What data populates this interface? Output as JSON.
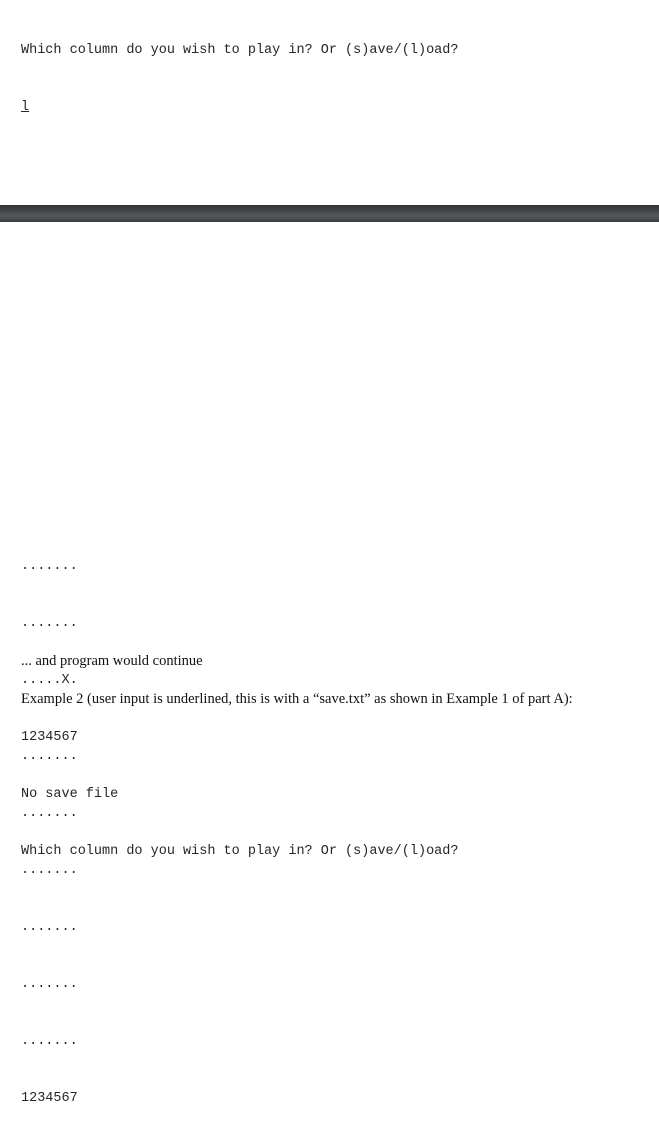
{
  "document": {
    "type": "assignment-handout-page",
    "page_break_divider_color": "#40464a",
    "background_color": "#ffffff",
    "mono_text_color": "#262626",
    "prose_text_color": "#111111"
  },
  "top_console": {
    "lines": [
      {
        "text": "Which column do you wish to play in? Or (s)ave/(l)oad?",
        "underlined": false
      },
      {
        "text": "l",
        "underlined": true
      },
      {
        "text": "",
        "underlined": false
      },
      {
        "text": ".......",
        "underlined": false
      },
      {
        "text": ".......",
        "underlined": false
      },
      {
        "text": ".......",
        "underlined": false
      }
    ]
  },
  "mid_console": {
    "lines": [
      {
        "text": ".......",
        "underlined": false
      },
      {
        "text": ".......",
        "underlined": false
      },
      {
        "text": ".....X.",
        "underlined": false
      },
      {
        "text": "1234567",
        "underlined": false
      },
      {
        "text": "No save file",
        "underlined": false
      },
      {
        "text": "Which column do you wish to play in? Or (s)ave/(l)oad?",
        "underlined": false
      }
    ]
  },
  "prose": {
    "continue_note": "... and program would continue",
    "example2_heading": "Example 2 (user input is underlined, this is with a “save.txt” as shown in Example 1 of part A):"
  },
  "bottom_console": {
    "lines": [
      {
        "text": ".......",
        "underlined": false
      },
      {
        "text": ".......",
        "underlined": false
      },
      {
        "text": ".......",
        "underlined": false
      },
      {
        "text": ".......",
        "underlined": false
      },
      {
        "text": ".......",
        "underlined": false
      },
      {
        "text": ".......",
        "underlined": false
      },
      {
        "text": "1234567",
        "underlined": false
      }
    ]
  }
}
